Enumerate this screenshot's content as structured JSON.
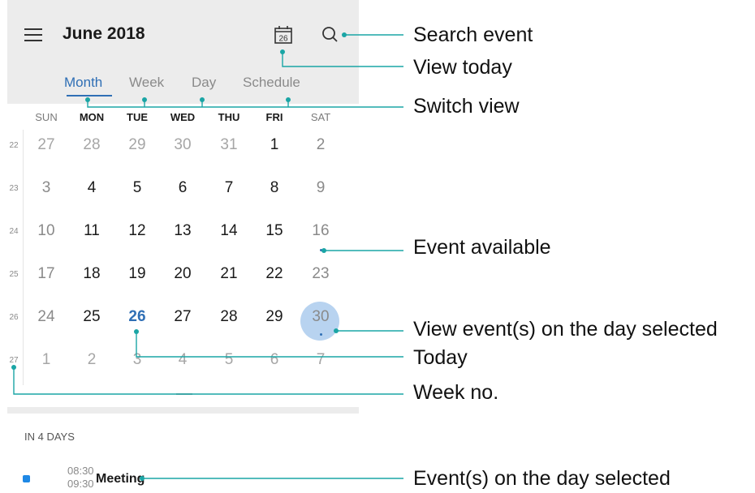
{
  "header": {
    "title": "June 2018",
    "calendar_icon_day": "26",
    "icons": [
      "menu-icon",
      "calendar-today-icon",
      "search-icon"
    ]
  },
  "tabs": [
    {
      "label": "Month",
      "active": true
    },
    {
      "label": "Week",
      "active": false
    },
    {
      "label": "Day",
      "active": false
    },
    {
      "label": "Schedule",
      "active": false
    }
  ],
  "weekdays": [
    "SUN",
    "MON",
    "TUE",
    "WED",
    "THU",
    "FRI",
    "SAT"
  ],
  "weeks": [
    {
      "no": "22",
      "days": [
        "27",
        "28",
        "29",
        "30",
        "31",
        "1",
        "2"
      ]
    },
    {
      "no": "23",
      "days": [
        "3",
        "4",
        "5",
        "6",
        "7",
        "8",
        "9"
      ]
    },
    {
      "no": "24",
      "days": [
        "10",
        "11",
        "12",
        "13",
        "14",
        "15",
        "16"
      ]
    },
    {
      "no": "25",
      "days": [
        "17",
        "18",
        "19",
        "20",
        "21",
        "22",
        "23"
      ]
    },
    {
      "no": "26",
      "days": [
        "24",
        "25",
        "26",
        "27",
        "28",
        "29",
        "30"
      ]
    },
    {
      "no": "27",
      "days": [
        "1",
        "2",
        "3",
        "4",
        "5",
        "6",
        "7"
      ]
    }
  ],
  "today": "26",
  "selected_day": "30",
  "event_days": [
    "16",
    "30"
  ],
  "agenda": {
    "heading": "IN 4 DAYS",
    "event": {
      "start": "08:30",
      "end": "09:30",
      "title": "Meeting"
    }
  },
  "callouts": {
    "search_event": "Search event",
    "view_today": "View today",
    "switch_view": "Switch view",
    "event_available": "Event available",
    "view_events_selected": "View event(s) on the day selected",
    "today": "Today",
    "week_no": "Week no.",
    "events_on_day": "Event(s) on the day selected"
  },
  "colors": {
    "accent": "#2f6fb5",
    "leader_line": "#1aa5a5",
    "selected_circle": "#b8d3f0",
    "event_marker": "#1e88e5"
  }
}
